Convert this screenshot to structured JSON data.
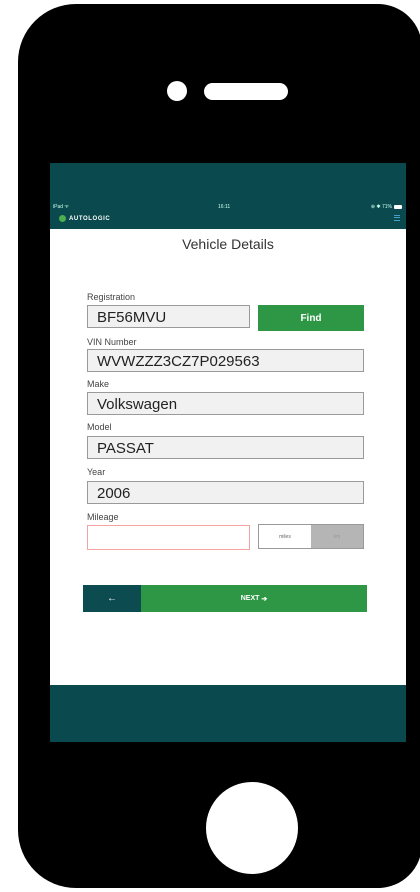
{
  "status": {
    "carrier": "iPad ᯤ",
    "time": "16:11",
    "battery": "⊕ ✱ 71%"
  },
  "brand": {
    "name": "AUTOLOGIC"
  },
  "page": {
    "title": "Vehicle Details"
  },
  "form": {
    "registration": {
      "label": "Registration",
      "value": "BF56MVU"
    },
    "vin": {
      "label": "VIN Number",
      "value": "WVWZZZ3CZ7P029563"
    },
    "make": {
      "label": "Make",
      "value": "Volkswagen"
    },
    "model": {
      "label": "Model",
      "value": "PASSAT"
    },
    "year": {
      "label": "Year",
      "value": "2006"
    },
    "mileage": {
      "label": "Mileage",
      "value": "",
      "unit_selected": "miles",
      "units": [
        "miles",
        "km"
      ]
    }
  },
  "buttons": {
    "find": "Find",
    "back": "←",
    "next": "NEXT",
    "next_arrow": "➔"
  },
  "colors": {
    "header": "#0a4a4e",
    "accent_green": "#2e9745",
    "error_border": "#f4a3a3"
  }
}
